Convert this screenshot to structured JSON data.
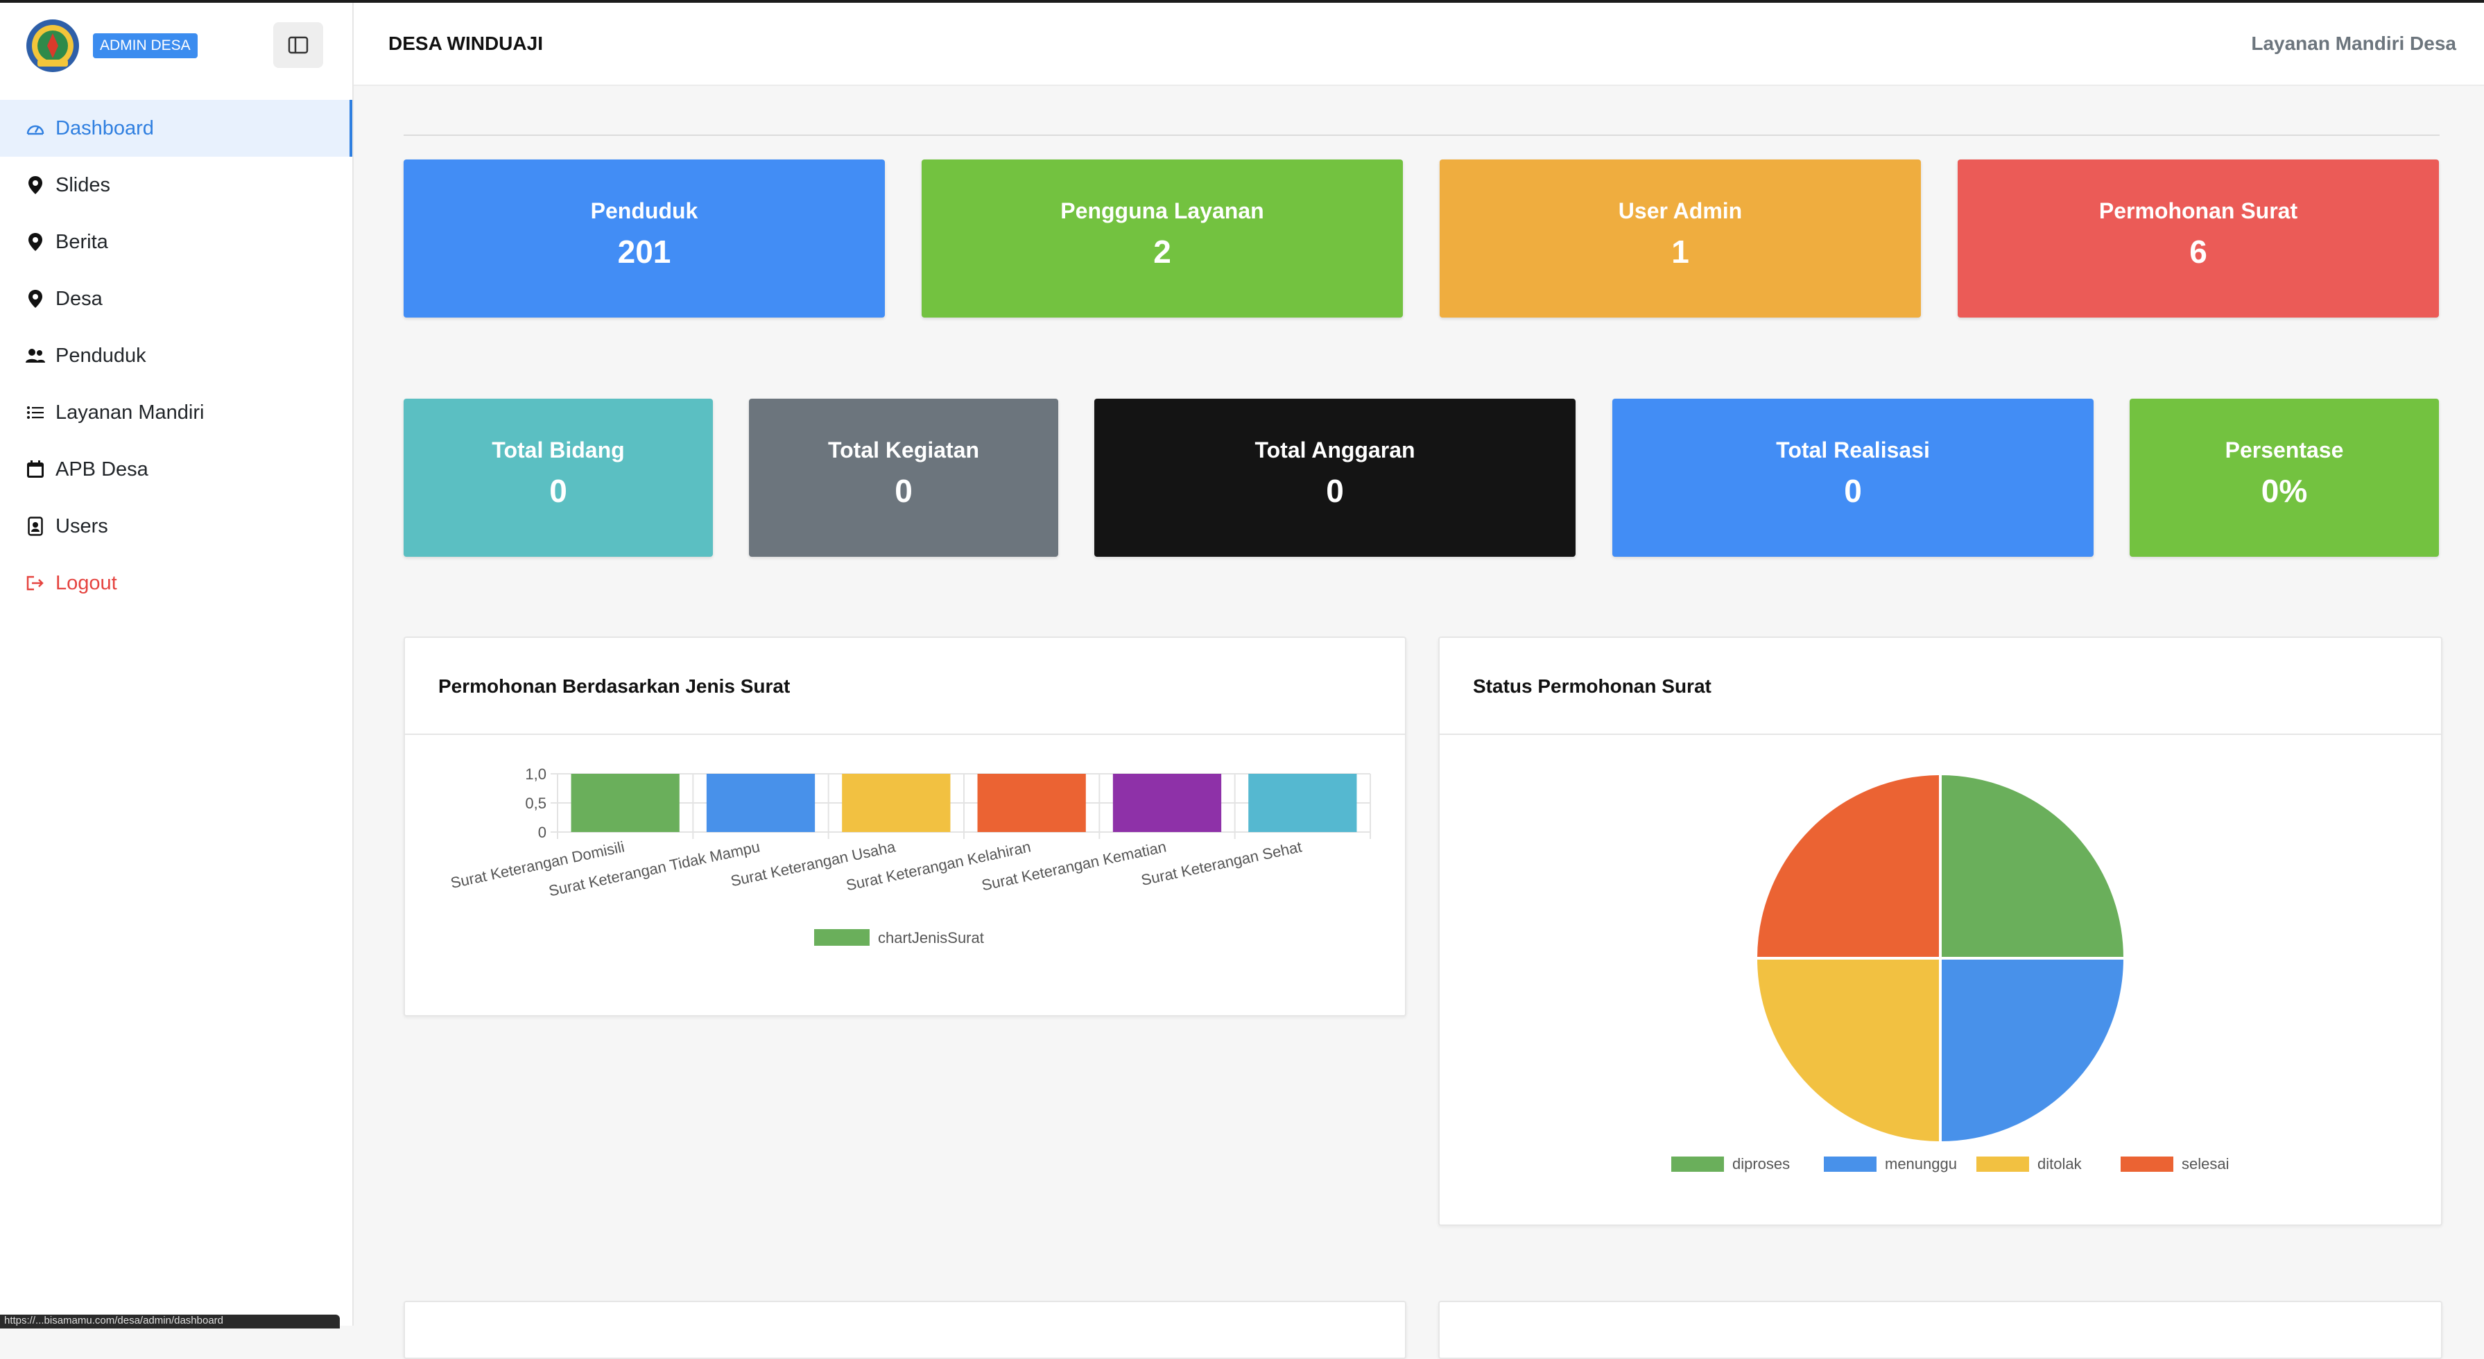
{
  "sidebar": {
    "badge": "ADMIN DESA",
    "items": [
      {
        "label": "Dashboard",
        "icon": "dashboard-icon"
      },
      {
        "label": "Slides",
        "icon": "map-pin-icon"
      },
      {
        "label": "Berita",
        "icon": "map-pin-icon"
      },
      {
        "label": "Desa",
        "icon": "map-pin-icon"
      },
      {
        "label": "Penduduk",
        "icon": "people-icon"
      },
      {
        "label": "Layanan Mandiri",
        "icon": "list-icon"
      },
      {
        "label": "APB Desa",
        "icon": "calendar-icon"
      },
      {
        "label": "Users",
        "icon": "person-badge-icon"
      },
      {
        "label": "Logout",
        "icon": "logout-icon"
      }
    ],
    "status_url": "https://...bisamamu.com/desa/admin/dashboard"
  },
  "header": {
    "title": "DESA WINDUAJI",
    "right": "Layanan Mandiri Desa"
  },
  "stats_row1": [
    {
      "label": "Penduduk",
      "value": "201",
      "color": "#428df5"
    },
    {
      "label": "Pengguna Layanan",
      "value": "2",
      "color": "#73c240"
    },
    {
      "label": "User Admin",
      "value": "1",
      "color": "#efad3f"
    },
    {
      "label": "Permohonan Surat",
      "value": "6",
      "color": "#eb5b57"
    }
  ],
  "stats_row2": [
    {
      "label": "Total Bidang",
      "value": "0",
      "color": "#5bbfc2"
    },
    {
      "label": "Total Kegiatan",
      "value": "0",
      "color": "#6c757d"
    },
    {
      "label": "Total Anggaran",
      "value": "0",
      "color": "#141414"
    },
    {
      "label": "Total Realisasi",
      "value": "0",
      "color": "#428df5"
    },
    {
      "label": "Persentase",
      "value": "0%",
      "color": "#73c240"
    }
  ],
  "panels": {
    "bar_title": "Permohonan Berdasarkan Jenis Surat",
    "pie_title": "Status Permohonan Surat"
  },
  "chart_data": [
    {
      "type": "bar",
      "categories": [
        "Surat Keterangan Domisili",
        "Surat Keterangan Tidak Mampu",
        "Surat Keterangan Usaha",
        "Surat Keterangan Kelahiran",
        "Surat Keterangan Kematian",
        "Surat Keterangan Sehat"
      ],
      "series": [
        {
          "name": "chartJenisSurat",
          "values": [
            1,
            1,
            1,
            1,
            1,
            1
          ]
        }
      ],
      "colors": [
        "#6aaf5b",
        "#4891ea",
        "#f2c141",
        "#eb6333",
        "#8e31a8",
        "#55b8d0"
      ],
      "yticks": [
        "1,0",
        "0,5",
        "0"
      ],
      "ylim": [
        0,
        1
      ],
      "grid": true,
      "legend": "bottom"
    },
    {
      "type": "pie",
      "labels": [
        "diproses",
        "menunggu",
        "ditolak",
        "selesai"
      ],
      "values": [
        1,
        1,
        1,
        1
      ],
      "colors": [
        "#6aaf5b",
        "#4891ea",
        "#f2c141",
        "#eb6333"
      ],
      "legend": "bottom"
    }
  ]
}
